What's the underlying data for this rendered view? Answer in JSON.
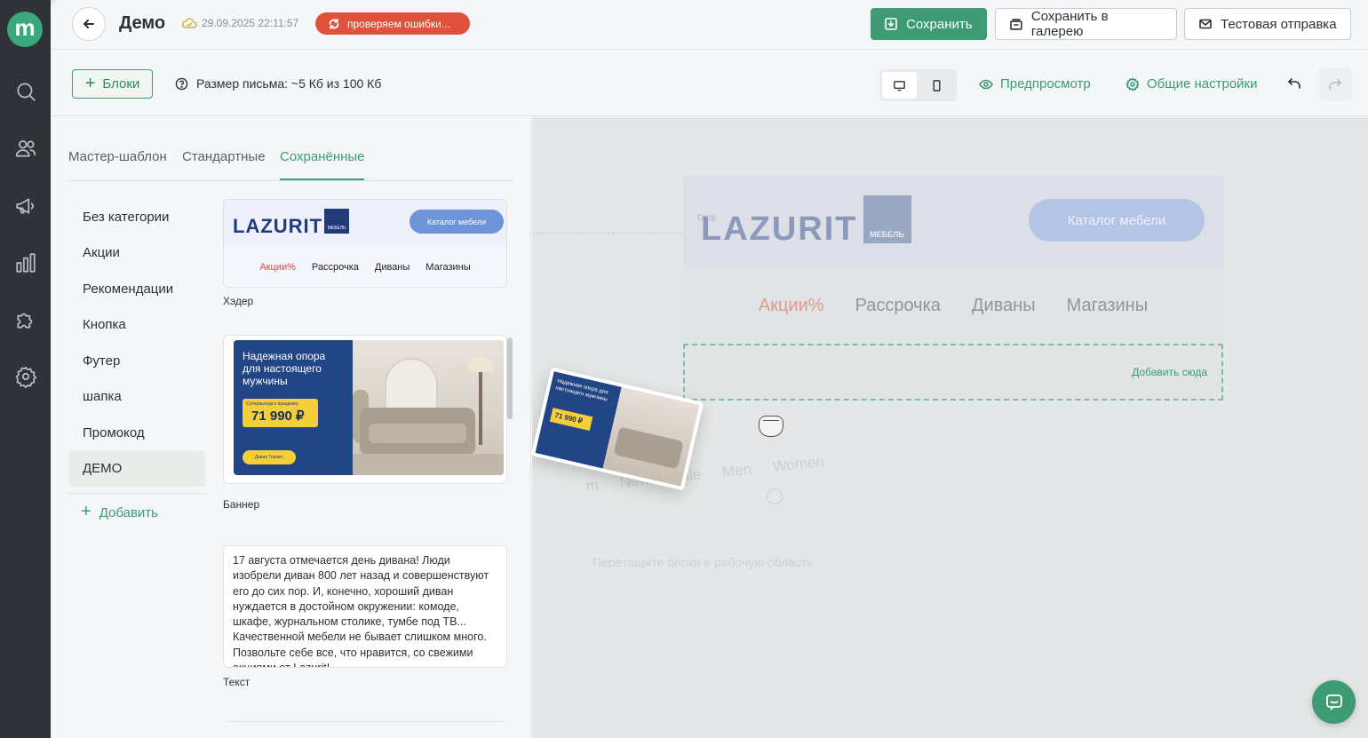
{
  "app": {
    "logo_letter": "m"
  },
  "header": {
    "title": "Демо",
    "saved_time": "29.09.2025 22:11:57",
    "status_badge": "проверяем ошибки...",
    "save_label": "Сохранить",
    "save_gallery_label": "Сохранить в галерею",
    "test_send_label": "Тестовая отправка"
  },
  "toolbar": {
    "blocks_label": "Блоки",
    "size_info": "Размер письма: ~5 Кб из 100 Кб",
    "preview_label": "Предпросмотр",
    "settings_label": "Общие настройки"
  },
  "panel": {
    "tabs": [
      {
        "label": "Мастер-шаблон"
      },
      {
        "label": "Стандартные"
      },
      {
        "label": "Сохранённые"
      }
    ],
    "active_tab": "Сохранённые",
    "categories": [
      {
        "label": "Без категории"
      },
      {
        "label": "Акции"
      },
      {
        "label": "Рекомендации"
      },
      {
        "label": "Кнопка"
      },
      {
        "label": "Футер"
      },
      {
        "label": "шапка"
      },
      {
        "label": "Промокод"
      },
      {
        "label": "ДЕМО"
      }
    ],
    "active_category": "ДЕМО",
    "add_category_label": "Добавить",
    "blocks": [
      {
        "label": "Хэдер",
        "logo_text": "LAZURIT",
        "logo_box_text": "МЕБЕЛЬ",
        "button": "Каталог мебели",
        "nav": [
          "Акции%",
          "Рассрочка",
          "Диваны",
          "Магазины"
        ]
      },
      {
        "label": "Баннер",
        "headline": "Надежная опора для настоящего мужчины",
        "tag_small": "Супервыгода к празднику",
        "price": "71 990 ₽",
        "cta": "Диван Гермес"
      },
      {
        "label": "Текст",
        "body": "17 августа отмечается день дивана! Люди изобрели диван 800 лет назад и совершенствуют его до сих пор. И, конечно, хороший диван нуждается в достойном окружении: комоде, шкафе, журнальном столике, тумбе под ТВ... Качественной мебели не бывает слишком много. Позвольте себе все, что нравится, со свежими акциями от Lazurit!"
      }
    ]
  },
  "canvas": {
    "header": {
      "hint": "Drop",
      "logo_text": "LAZURIT",
      "logo_box_text": "МЕБЕЛЬ",
      "button": "Каталог мебели",
      "nav": [
        "Акции%",
        "Рассрочка",
        "Диваны",
        "Магазины"
      ]
    },
    "drop_zone_label": "Добавить сюда",
    "ghost_items": [
      "m",
      "New",
      "Sale",
      "Men",
      "Women"
    ],
    "empty_hint": "Перетащите блоки в рабочую область",
    "dragging_block": {
      "headline": "Надежная опора для настоящего мужчины",
      "price": "71 990 ₽"
    }
  },
  "colors": {
    "accent": "#3e9b74",
    "rail": "#2f3337",
    "status_badge": "#e0513b",
    "brand_blue": "#213b7a"
  }
}
